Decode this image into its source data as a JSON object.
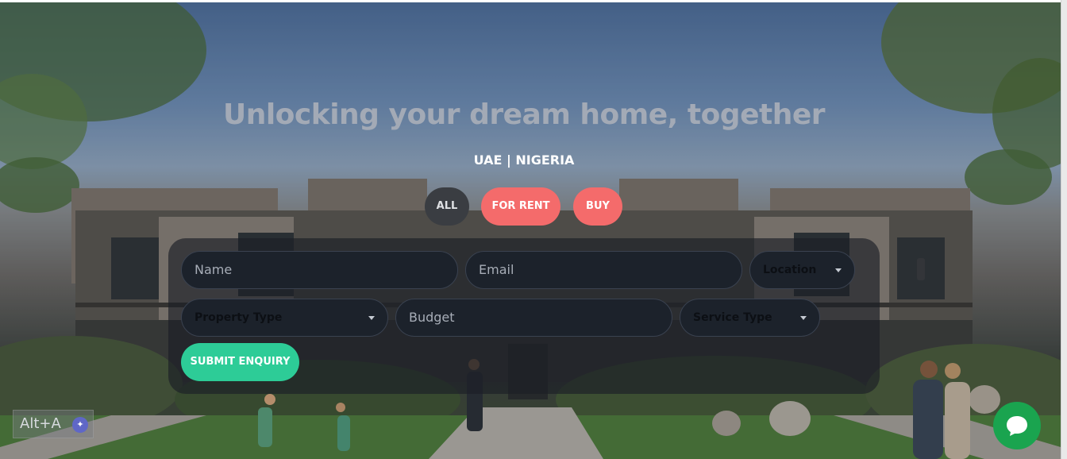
{
  "hero": {
    "headline": "Unlocking your dream home, together",
    "subline": "UAE | NIGERIA"
  },
  "filters": {
    "all": "ALL",
    "rent": "FOR RENT",
    "buy": "BUY"
  },
  "form": {
    "name_placeholder": "Name",
    "email_placeholder": "Email",
    "location": "Location",
    "property_type": "Property Type",
    "budget_placeholder": "Budget",
    "service_type": "Service Type",
    "submit": "SUBMIT ENQUIRY"
  },
  "shortcut_badge": {
    "label": "Alt+A"
  },
  "colors": {
    "accent_pink": "#f46b6b",
    "accent_green": "#2dcc97",
    "chat_green": "#1aa44f"
  },
  "icons": {
    "chat": "chat-bubble-icon",
    "caret": "chevron-down-icon"
  }
}
